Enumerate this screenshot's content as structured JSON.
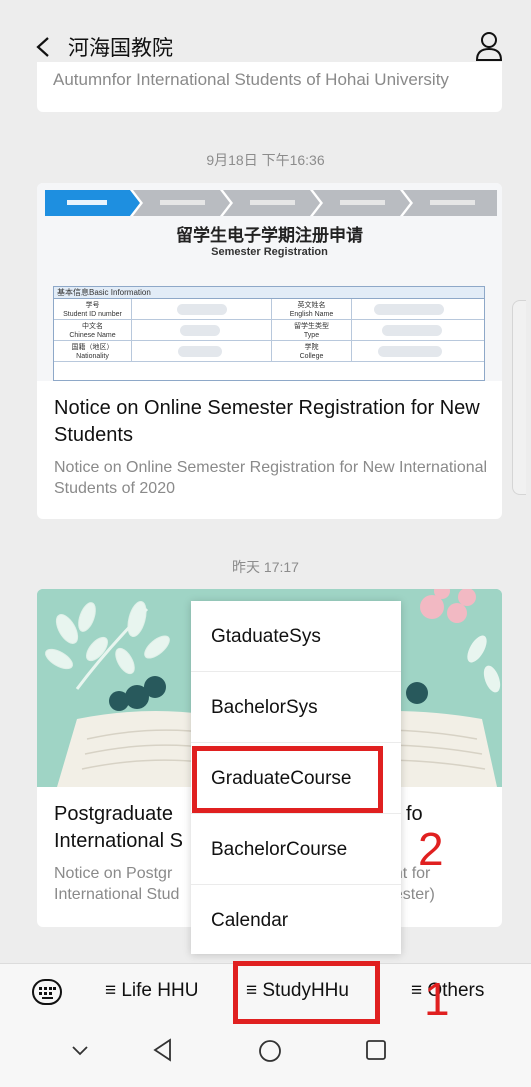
{
  "header": {
    "title": "河海国教院"
  },
  "previous_card": {
    "desc": "Autumnfor International Students of Hohai University"
  },
  "messages": [
    {
      "timestamp": "9月18日 下午16:36",
      "image": {
        "form_title": "留学生电子学期注册申请",
        "form_subtitle": "Semester Registration",
        "section_label": "基本信息Basic Information",
        "rows": [
          [
            "学号\nStudent ID number",
            "英文姓名\nEnglish Name"
          ],
          [
            "中文名\nChinese Name",
            "留学生类型\nType"
          ],
          [
            "国籍（地区）\nNationality",
            "学院\nCollege"
          ]
        ]
      },
      "title": "Notice on Online Semester Registration for New Students",
      "desc": "Notice on Online Semester Registration for New International Students of 2020"
    },
    {
      "timestamp": "昨天 17:17",
      "title_visible_left": "Postgraduate",
      "title_line2_left": "International S",
      "title_visible_right": "fo",
      "desc_line1_left": "Notice on Postgr",
      "desc_line1_right": "ent for",
      "desc_line2_left": "International Stud",
      "desc_line2_right": "nester)"
    }
  ],
  "dropdown": {
    "items": [
      "GtaduateSys",
      "BachelorSys",
      "GraduateCourse",
      "BachelorCourse",
      "Calendar"
    ]
  },
  "bottom_menu": {
    "items": [
      "≡ Life HHU",
      "≡ StudyHHu",
      "≡ Others"
    ]
  },
  "annotations": {
    "label_1": "1",
    "label_2": "2",
    "color": "#e02020"
  }
}
